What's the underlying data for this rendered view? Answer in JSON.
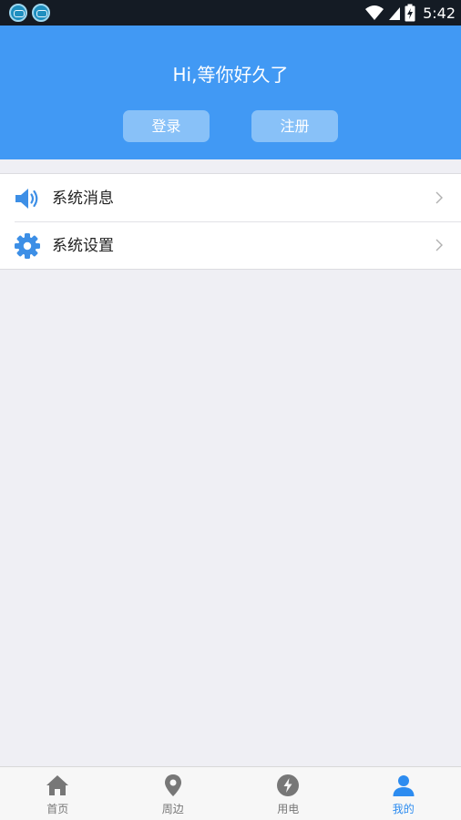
{
  "status_bar": {
    "time": "5:42",
    "icons": [
      "app-notification-icon",
      "app-notification-icon",
      "wifi-icon",
      "signal-icon",
      "battery-charging-icon"
    ]
  },
  "header": {
    "greeting": "Hi,等你好久了",
    "login_label": "登录",
    "register_label": "注册"
  },
  "menu": {
    "items": [
      {
        "label": "系统消息",
        "icon": "speaker-icon"
      },
      {
        "label": "系统设置",
        "icon": "gear-icon"
      }
    ]
  },
  "tabbar": {
    "tabs": [
      {
        "label": "首页",
        "icon": "home-icon",
        "active": false
      },
      {
        "label": "周边",
        "icon": "location-pin-icon",
        "active": false
      },
      {
        "label": "用电",
        "icon": "lightning-icon",
        "active": false
      },
      {
        "label": "我的",
        "icon": "user-icon",
        "active": true
      }
    ]
  },
  "colors": {
    "primary": "#4199f4",
    "header_button": "#88c1f8",
    "tab_active": "#2d8cf0",
    "tab_inactive": "#777777",
    "page_background": "#efeff4"
  }
}
